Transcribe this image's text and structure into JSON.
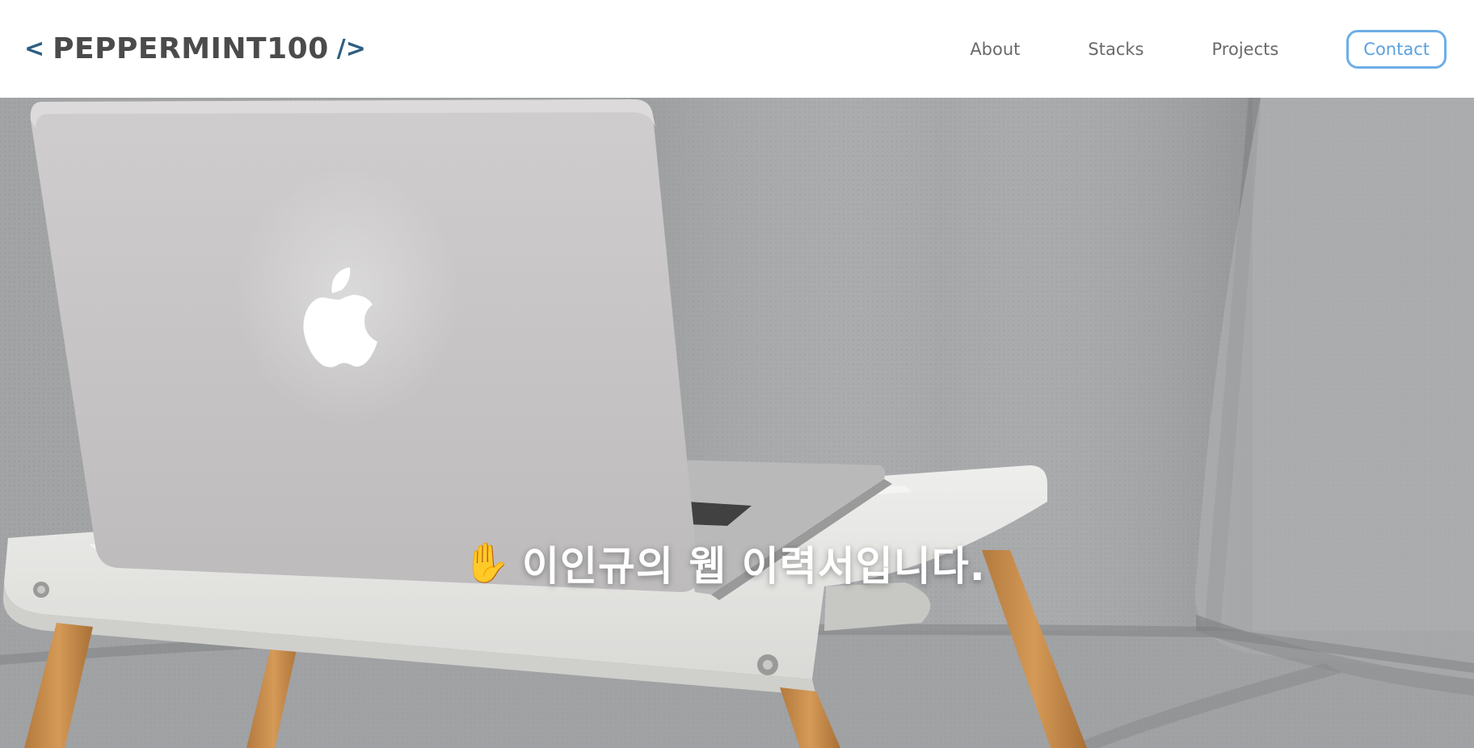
{
  "header": {
    "logo": {
      "open_bracket": "<",
      "name": "PEPPERMINT100",
      "close_bracket": "/>"
    },
    "nav": {
      "about": "About",
      "stacks": "Stacks",
      "projects": "Projects",
      "contact": "Contact"
    }
  },
  "hero": {
    "hand_icon": "✋",
    "message": "이인규의 웹 이력서입니다."
  },
  "colors": {
    "logo_bracket": "#2d5f82",
    "logo_text": "#4b4b4b",
    "nav_text": "#6a6a6a",
    "contact_accent": "#5aa2e0"
  }
}
